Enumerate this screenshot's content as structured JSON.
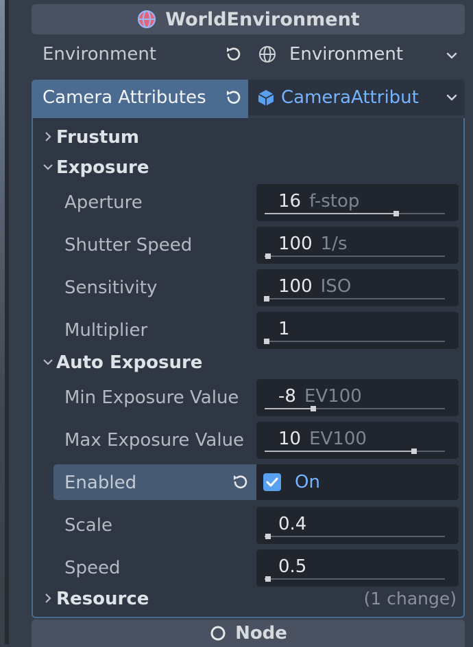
{
  "header": {
    "title": "WorldEnvironment",
    "icon": "globe-icon",
    "icon_color": "#e0677a"
  },
  "environment": {
    "label": "Environment",
    "value": "Environment"
  },
  "camera_attributes": {
    "label": "Camera Attributes",
    "value": "CameraAttribut",
    "accent": "#75b4ff"
  },
  "sections": {
    "frustum": "Frustum",
    "exposure": "Exposure",
    "auto_exposure": "Auto Exposure",
    "resource": "Resource",
    "resource_changes": "(1 change)"
  },
  "exposure_props": [
    {
      "label": "Aperture",
      "value": "16",
      "unit": "f-stop",
      "slider": 0.73
    },
    {
      "label": "Shutter Speed",
      "value": "100",
      "unit": "1/s",
      "slider": 0.02
    },
    {
      "label": "Sensitivity",
      "value": "100",
      "unit": "ISO",
      "slider": 0.01
    },
    {
      "label": "Multiplier",
      "value": "1",
      "unit": "",
      "slider": 0.01
    }
  ],
  "auto_exposure_props": [
    {
      "label": "Min Exposure Value",
      "value": "-8",
      "unit": "EV100",
      "slider": 0.27
    },
    {
      "label": "Max Exposure Value",
      "value": "10",
      "unit": "EV100",
      "slider": 0.83
    }
  ],
  "enabled": {
    "label": "Enabled",
    "checked": true,
    "text": "On"
  },
  "auto_exposure_props_2": [
    {
      "label": "Scale",
      "value": "0.4",
      "unit": "",
      "slider": 0.02
    },
    {
      "label": "Speed",
      "value": "0.5",
      "unit": "",
      "slider": 0.02
    }
  ],
  "footer": {
    "title": "Node",
    "icon": "node-circle-icon"
  }
}
